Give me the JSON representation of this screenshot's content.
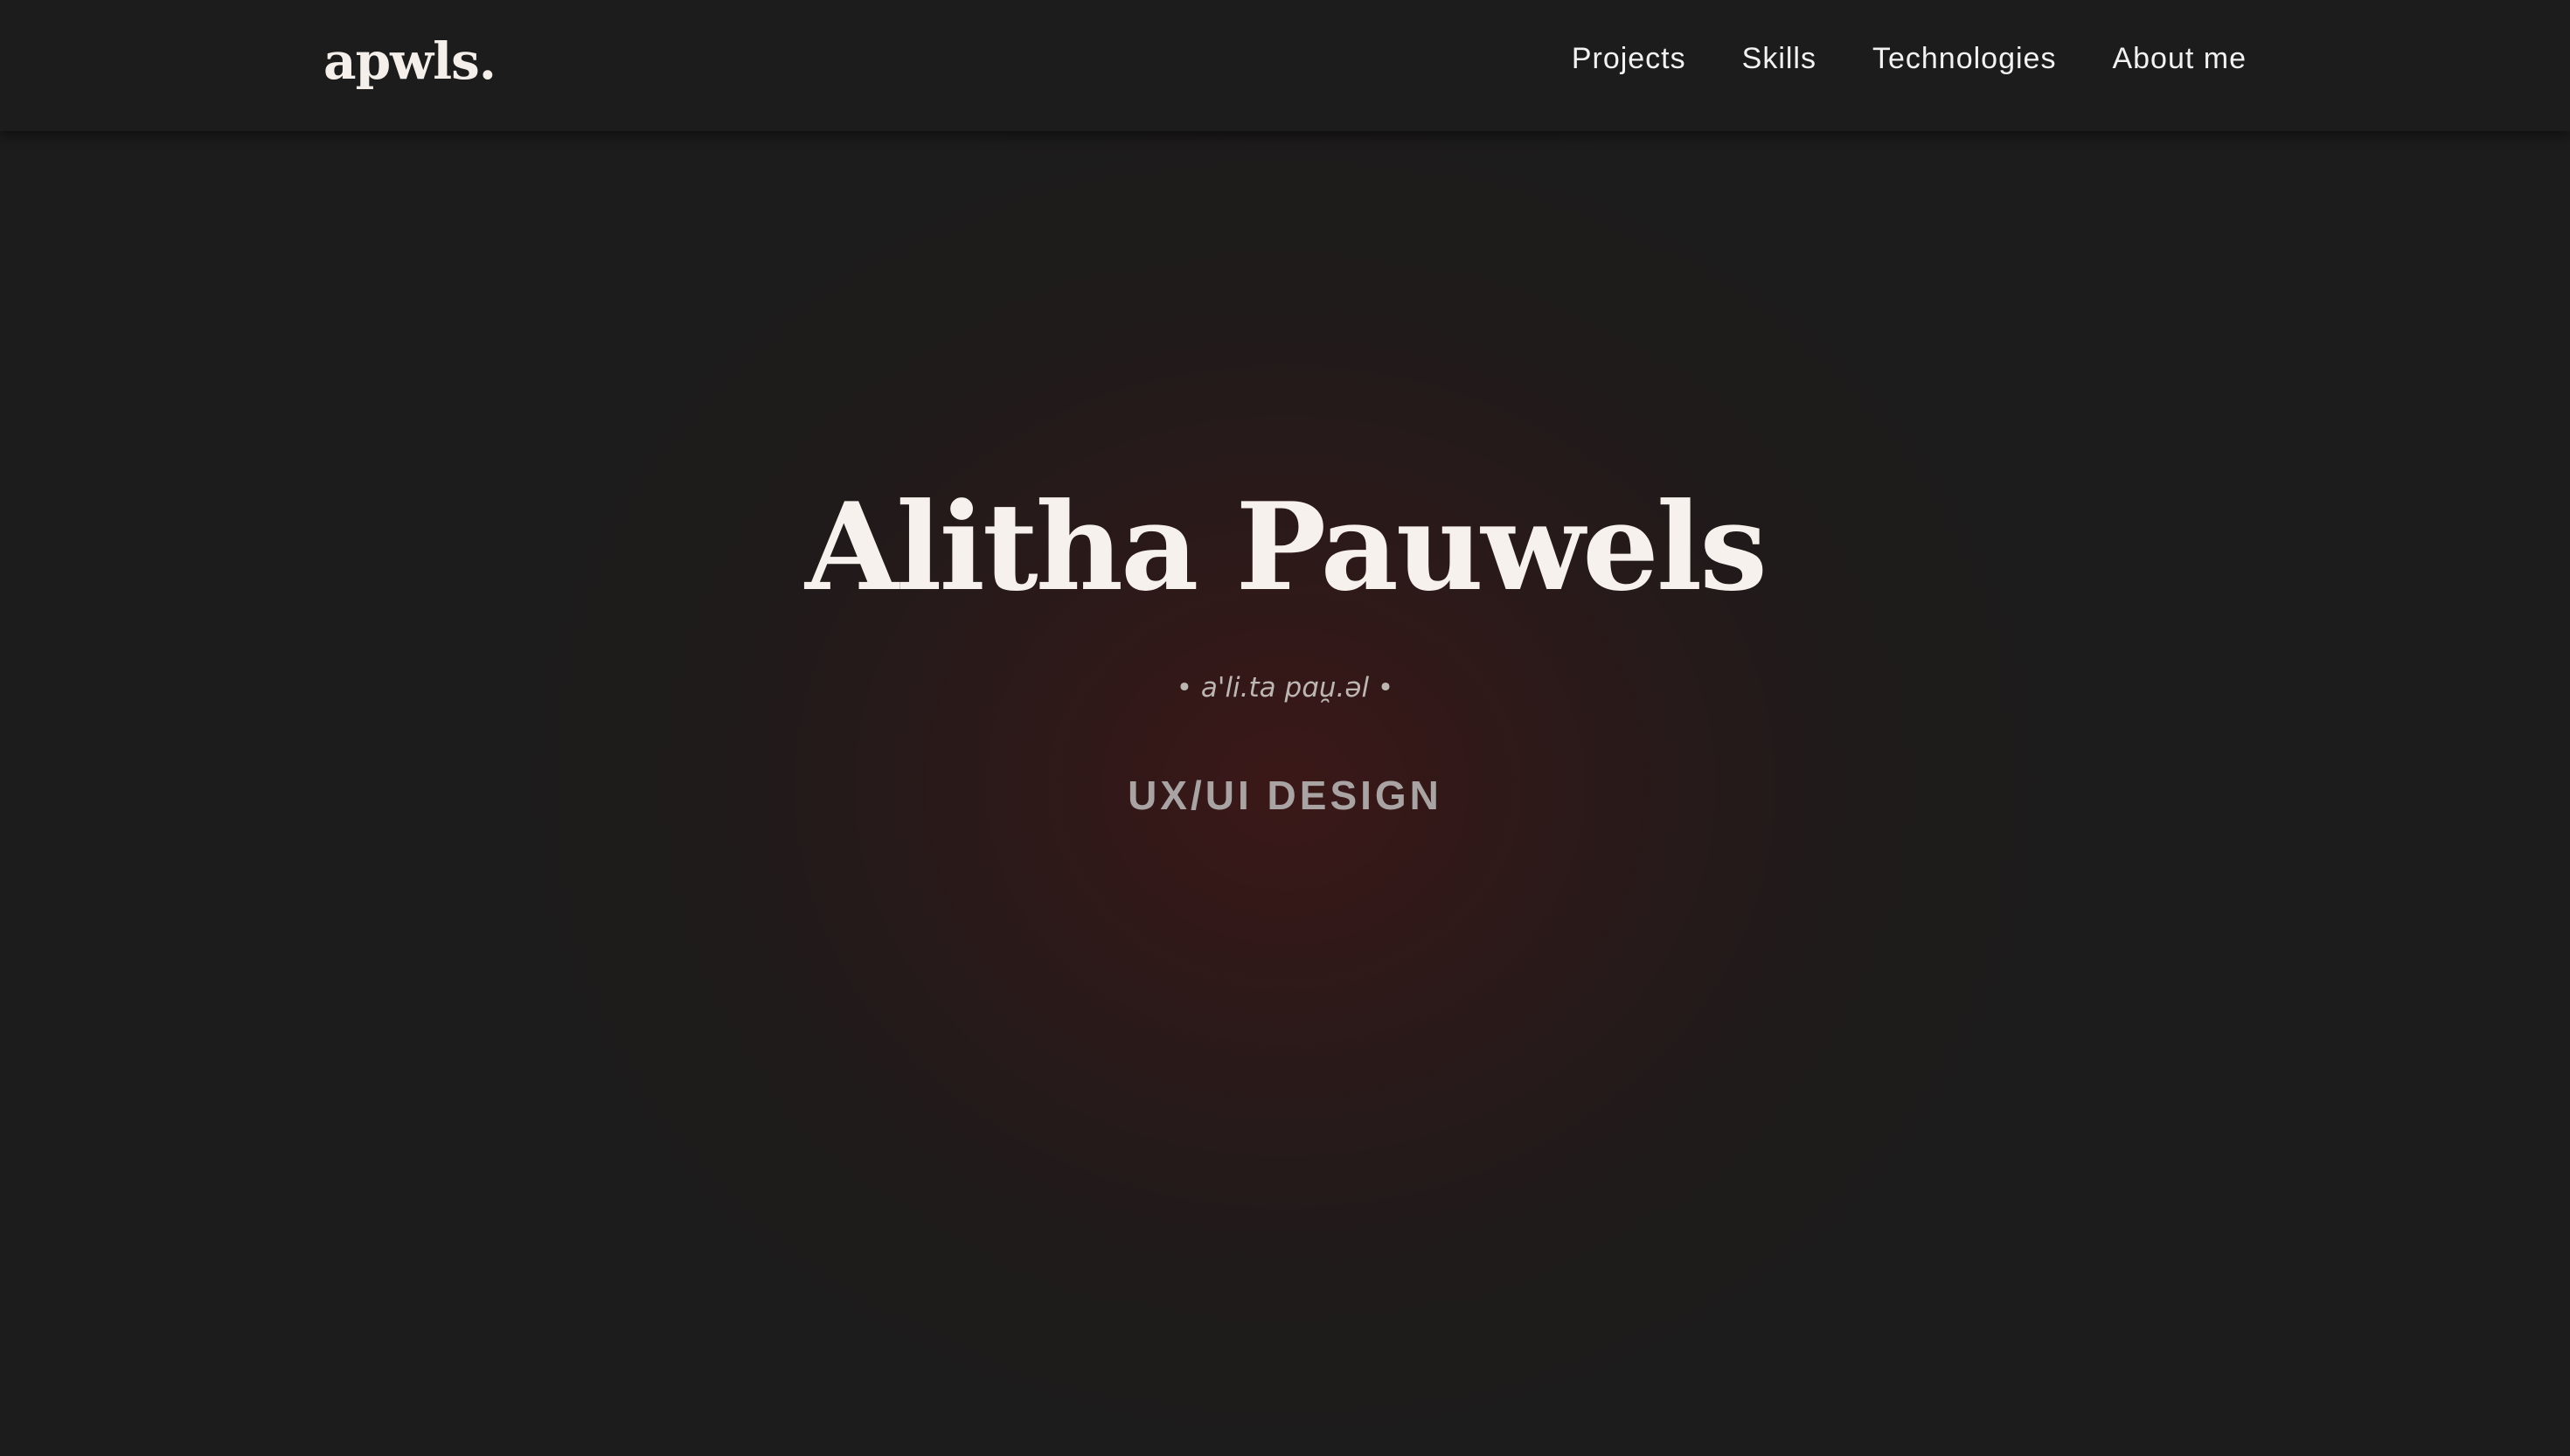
{
  "header": {
    "logo": "apwls.",
    "nav": [
      {
        "label": "Projects"
      },
      {
        "label": "Skills"
      },
      {
        "label": "Technologies"
      },
      {
        "label": "About me"
      }
    ]
  },
  "hero": {
    "name": "Alitha Pauwels",
    "pronunciation": "• a'li.ta pɑu̯.əl •",
    "role": "UX/UI DESIGN"
  },
  "colors": {
    "background": "#1c1c1c",
    "accent_glow": "#481616",
    "text_primary": "#f6f1ec",
    "text_muted": "#a9a4a3"
  }
}
